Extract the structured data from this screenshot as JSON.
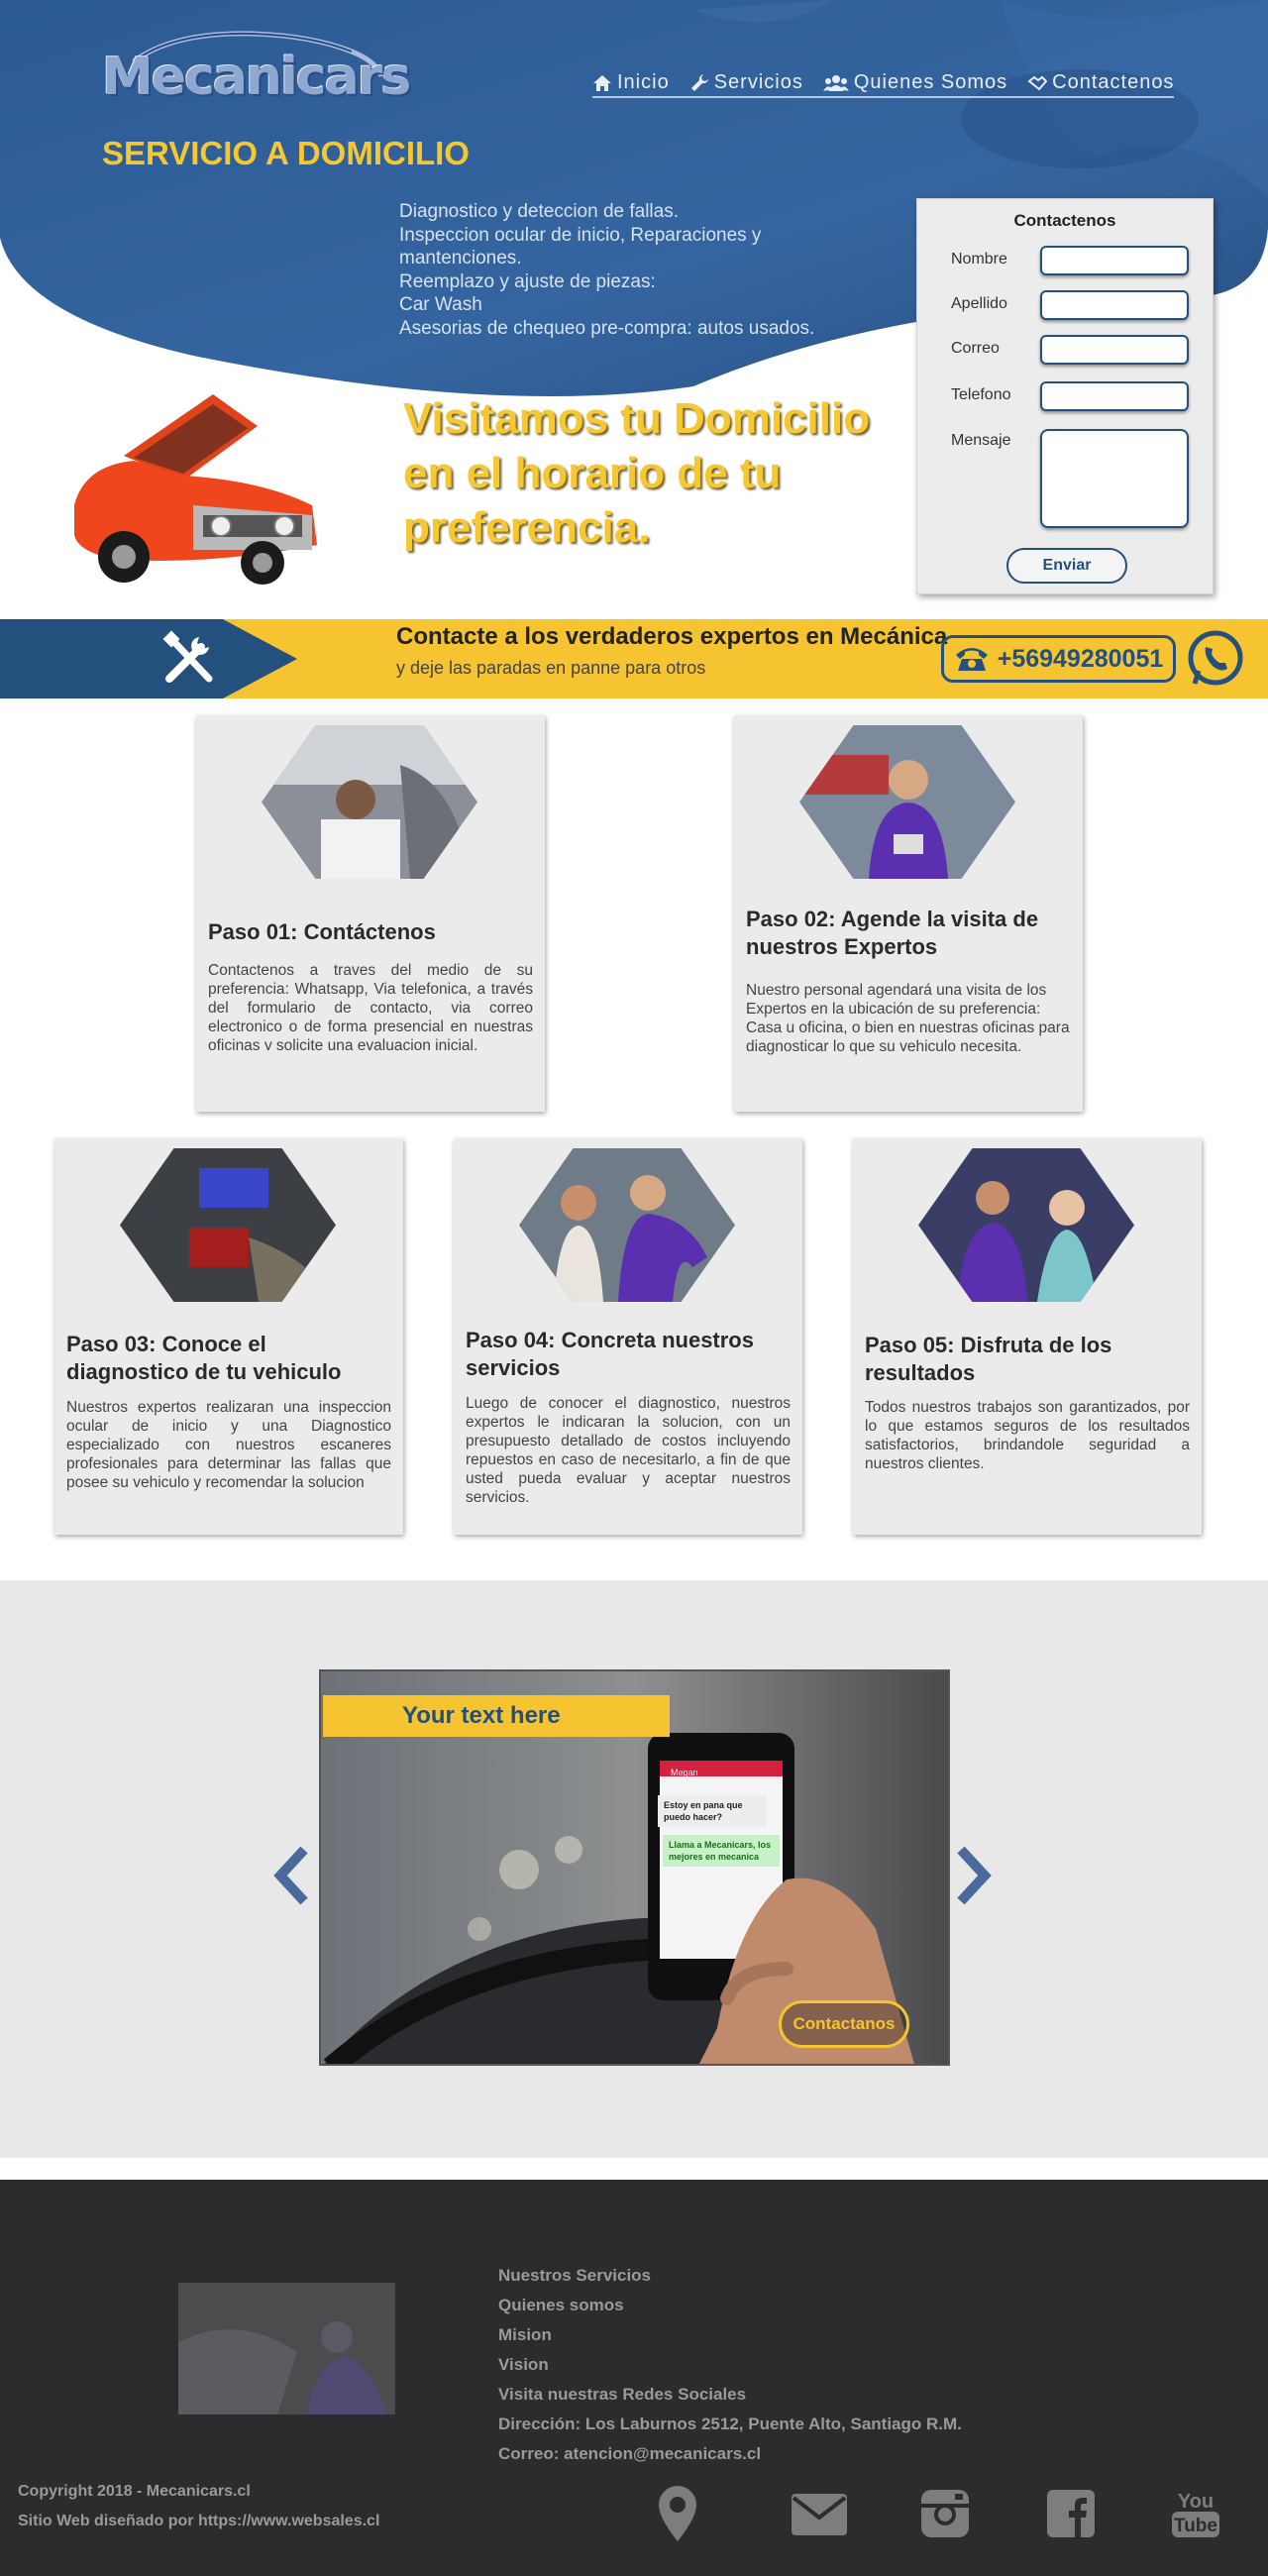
{
  "brand": {
    "logo_text": "Mecanicars"
  },
  "nav": [
    {
      "label": "Inicio",
      "icon": "home-icon"
    },
    {
      "label": "Servicios",
      "icon": "wrench-icon"
    },
    {
      "label": "Quienes  Somos",
      "icon": "users-icon"
    },
    {
      "label": "Contactenos",
      "icon": "handshake-icon"
    }
  ],
  "hero": {
    "title": "SERVICIO A DOMICILIO",
    "services": [
      "Diagnostico y deteccion de fallas.",
      "Inspeccion ocular de inicio, Reparaciones y mantenciones.",
      "Reemplazo y ajuste de piezas:",
      "Car Wash",
      "Asesorias de chequeo pre-compra: autos usados."
    ],
    "tagline": "Visitamos tu Domicilio en el horario de tu preferencia."
  },
  "contact_form": {
    "title": "Contactenos",
    "fields": [
      "Nombre",
      "Apellido",
      "Correo",
      "Telefono"
    ],
    "message_label": "Mensaje",
    "submit": "Enviar"
  },
  "banner": {
    "title": "Contacte a los verdaderos expertos en Mecánica",
    "subtitle": "y deje las paradas en panne para otros",
    "phone": "+56949280051"
  },
  "steps": [
    {
      "title": "Paso 01: Contáctenos",
      "text": "Contactenos a traves del medio de su preferencia: Whatsapp, Via telefonica, a través del formulario de contacto, via correo electronico o de forma presencial en nuestras oficinas y solicite una evaluacion inicial."
    },
    {
      "title": "Paso 02: Agende la visita de nuestros Expertos",
      "text": "Nuestro personal agendará una visita de los Expertos en la ubicación de su preferencia: Casa u oficina, o bien en nuestras oficinas para diagnosticar lo que su vehiculo necesita."
    },
    {
      "title": "Paso 03: Conoce el diagnostico de tu vehiculo",
      "text": "Nuestros expertos realizaran una inspeccion ocular de inicio y una Diagnostico especializado con nuestros escaneres profesionales para determinar las fallas que posee su vehiculo y recomendar la solucion"
    },
    {
      "title": "Paso 04: Concreta nuestros servicios",
      "text": "Luego de conocer el diagnostico, nuestros expertos le indicaran la solucion, con un presupuesto detallado de costos incluyendo repuestos en caso de necesitarlo, a fin de que usted pueda evaluar y aceptar nuestros servicios."
    },
    {
      "title": "Paso 05: Disfruta de los resultados",
      "text": "Todos nuestros trabajos son garantizados, por lo que estamos seguros de los resultados satisfactorios, brindandole seguridad a nuestros clientes."
    }
  ],
  "carousel": {
    "tag": "Your text here",
    "chat_title": "Megan",
    "chat_message": "Estoy en pana que puedo hacer?",
    "chat_reply": "Llama a Mecanicars, los mejores en mecanica",
    "button": "Contactanos"
  },
  "footer": {
    "links": [
      "Nuestros Servicios",
      "Quienes somos",
      "Mision",
      "Vision",
      "Visita nuestras Redes Sociales"
    ],
    "address": "Dirección: Los Laburnos 2512, Puente Alto, Santiago R.M.",
    "email": "Correo: atencion@mecanicars.cl",
    "copyright": "Copyright 2018 - Mecanicars.cl",
    "credit": "Sitio Web diseñado por https://www.websales.cl",
    "social": [
      "location-icon",
      "mail-icon",
      "instagram-icon",
      "facebook-icon",
      "youtube-icon"
    ]
  },
  "colors": {
    "primary": "#24507e",
    "accent": "#f5c430",
    "hero_bg": "#2f5d93",
    "footer_bg": "#2c2c2e"
  }
}
